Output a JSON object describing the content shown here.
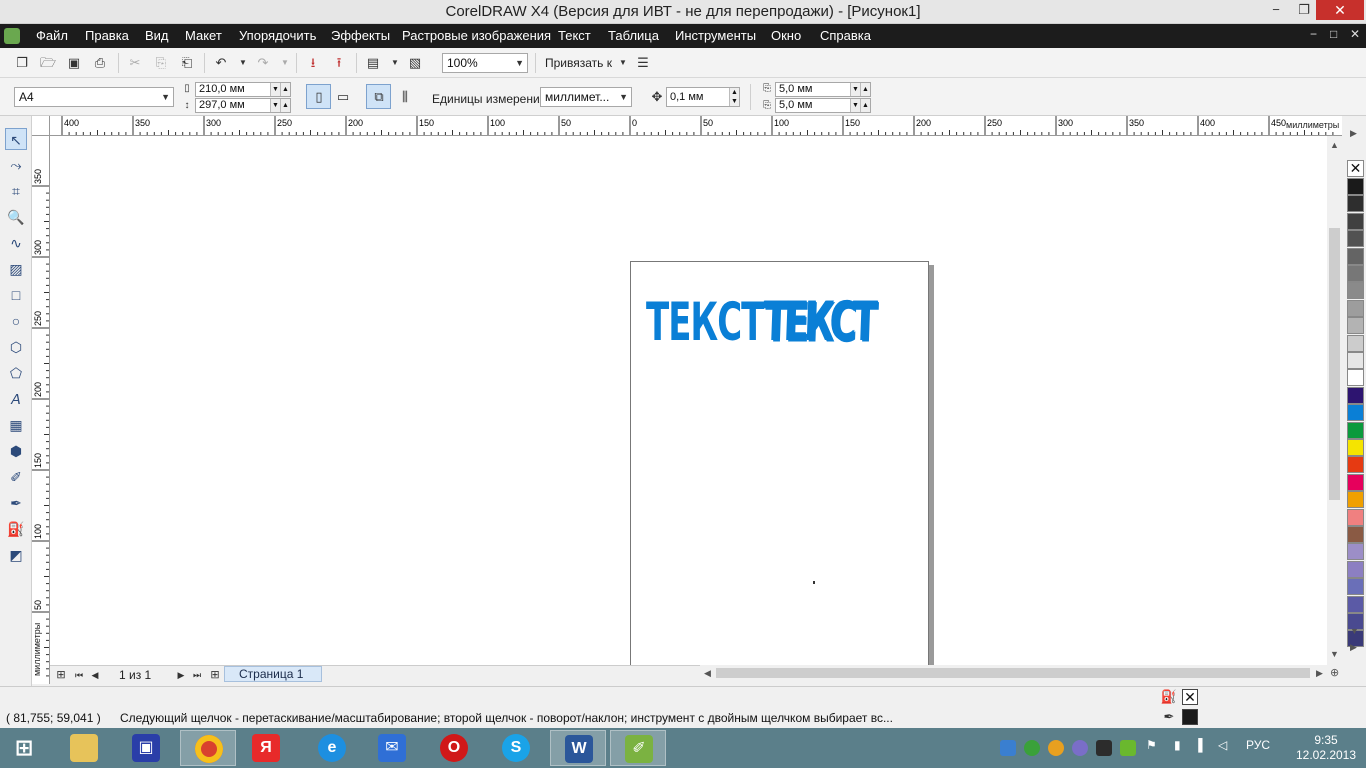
{
  "window": {
    "title": "CorelDRAW X4 (Версия для ИВТ - не для перепродажи) - [Рисунок1]",
    "min": "−",
    "max": "❐",
    "close": "✕"
  },
  "menu": {
    "items": [
      {
        "label": "Файл"
      },
      {
        "label": "Правка"
      },
      {
        "label": "Вид"
      },
      {
        "label": "Макет"
      },
      {
        "label": "Упорядочить"
      },
      {
        "label": "Эффекты"
      },
      {
        "label": "Растровые изображения"
      },
      {
        "label": "Текст"
      },
      {
        "label": "Таблица"
      },
      {
        "label": "Инструменты"
      },
      {
        "label": "Окно"
      },
      {
        "label": "Справка"
      }
    ],
    "mdi_min": "−",
    "mdi_max": "□",
    "mdi_close": "✕"
  },
  "toolbar": {
    "zoom": "100%",
    "snap_label": "Привязать к"
  },
  "property_bar": {
    "paper_size": "A4",
    "width": "210,0 мм",
    "height": "297,0 мм",
    "units_label": "Единицы измерения:",
    "units_value": "миллимет...",
    "nudge": "0,1 мм",
    "dup_x": "5,0 мм",
    "dup_y": "5,0 мм"
  },
  "rulers": {
    "top_labels": [
      "400",
      "350",
      "300",
      "250",
      "200",
      "150",
      "100",
      "50",
      "0",
      "50",
      "100",
      "150",
      "200",
      "250",
      "300",
      "350",
      "400",
      "450"
    ],
    "top_unit": "миллиметры",
    "left_labels": [
      "350",
      "300",
      "250",
      "200",
      "150",
      "100",
      "50"
    ],
    "left_unit": "миллиметры"
  },
  "canvas": {
    "text1": "ТЕКСТ",
    "text2": "ТЕКСТ",
    "text_color": "#0a7fd6"
  },
  "pagenav": {
    "counter": "1 из 1",
    "tab": "Страница 1"
  },
  "status": {
    "coords": "( 81,755; 59,041 )",
    "message": "Следующий щелчок - перетаскивание/масштабирование; второй щелчок - поворот/наклон; инструмент с двойным щелчком выбирает вс..."
  },
  "palette": [
    "#1a1a1a",
    "#2e2e2e",
    "#404040",
    "#525252",
    "#646464",
    "#777777",
    "#8a8a8a",
    "#9d9d9d",
    "#b3b3b3",
    "#cccccc",
    "#e6e6e6",
    "#ffffff",
    "#2d1470",
    "#0a7fd6",
    "#0a9a3c",
    "#f5e400",
    "#e63a12",
    "#e6005c",
    "#f0a000",
    "#f08080",
    "#8a5a44",
    "#9c8ec7",
    "#8c7fc2",
    "#6a6fb8",
    "#5b5aa6",
    "#4a4a90",
    "#3a3a78"
  ],
  "taskbar": {
    "time": "9:35",
    "date": "12.02.2013",
    "lang": "РУС"
  }
}
